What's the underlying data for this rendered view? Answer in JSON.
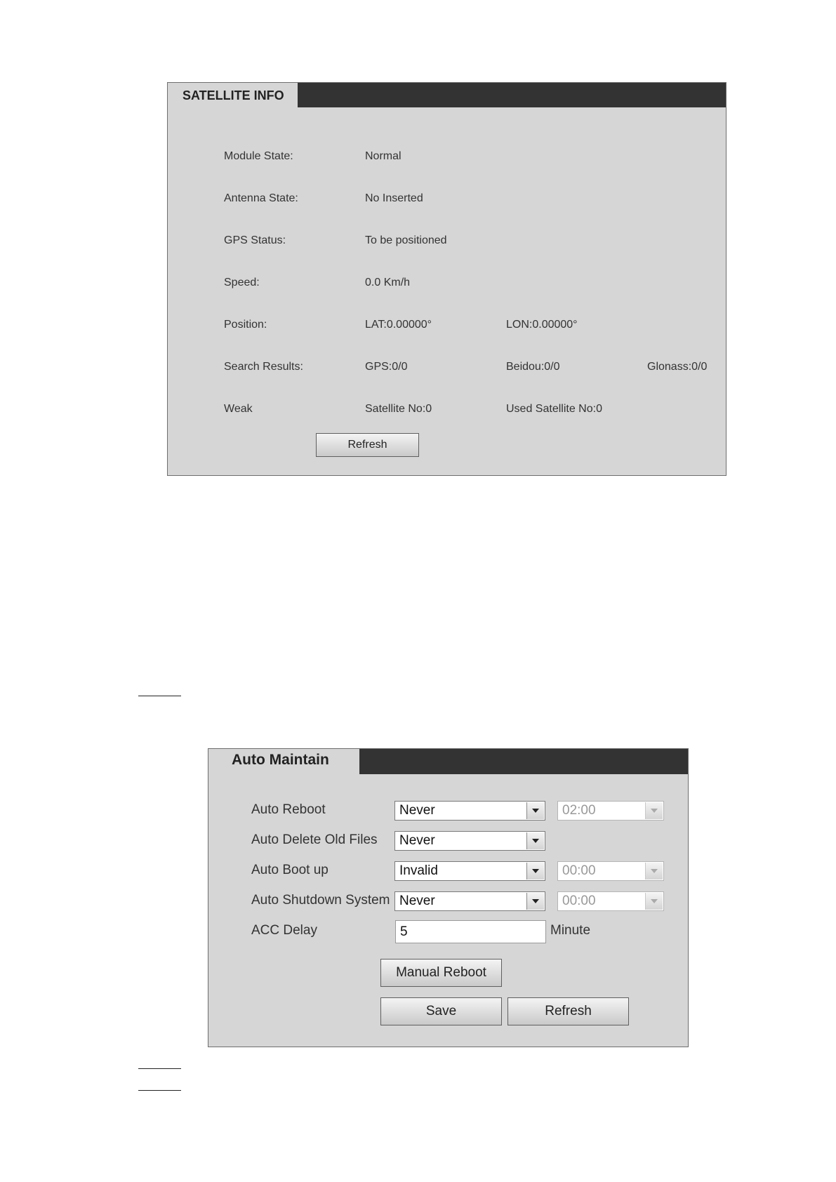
{
  "satellite_panel": {
    "title": "SATELLITE INFO",
    "rows": [
      {
        "label": "Module State:",
        "values": [
          "Normal"
        ]
      },
      {
        "label": "Antenna State:",
        "values": [
          "No Inserted"
        ]
      },
      {
        "label": "GPS Status:",
        "values": [
          "To be positioned"
        ]
      },
      {
        "label": "Speed:",
        "values": [
          "0.0 Km/h"
        ]
      },
      {
        "label": "Position:",
        "values": [
          "LAT:0.00000°",
          "LON:0.00000°"
        ]
      },
      {
        "label": "Search Results:",
        "values": [
          "GPS:0/0",
          "Beidou:0/0",
          "Glonass:0/0"
        ]
      },
      {
        "label": "Weak",
        "values": [
          "Satellite No:0",
          "Used Satellite No:0"
        ]
      }
    ],
    "refresh_label": "Refresh"
  },
  "auto_maintain_panel": {
    "title": "Auto Maintain",
    "auto_reboot": {
      "label": "Auto Reboot",
      "value": "Never",
      "time": "02:00"
    },
    "auto_delete": {
      "label": "Auto Delete Old Files",
      "value": "Never"
    },
    "auto_boot": {
      "label": "Auto Boot up",
      "value": "Invalid",
      "time": "00:00"
    },
    "auto_shutdown": {
      "label": "Auto Shutdown System",
      "value": "Never",
      "time": "00:00"
    },
    "acc_delay": {
      "label": "ACC Delay",
      "value": "5",
      "unit": "Minute"
    },
    "manual_reboot_label": "Manual Reboot",
    "save_label": "Save",
    "refresh_label": "Refresh"
  },
  "colors": {
    "panel_bg": "#d6d6d6",
    "header_bar": "#333333"
  }
}
